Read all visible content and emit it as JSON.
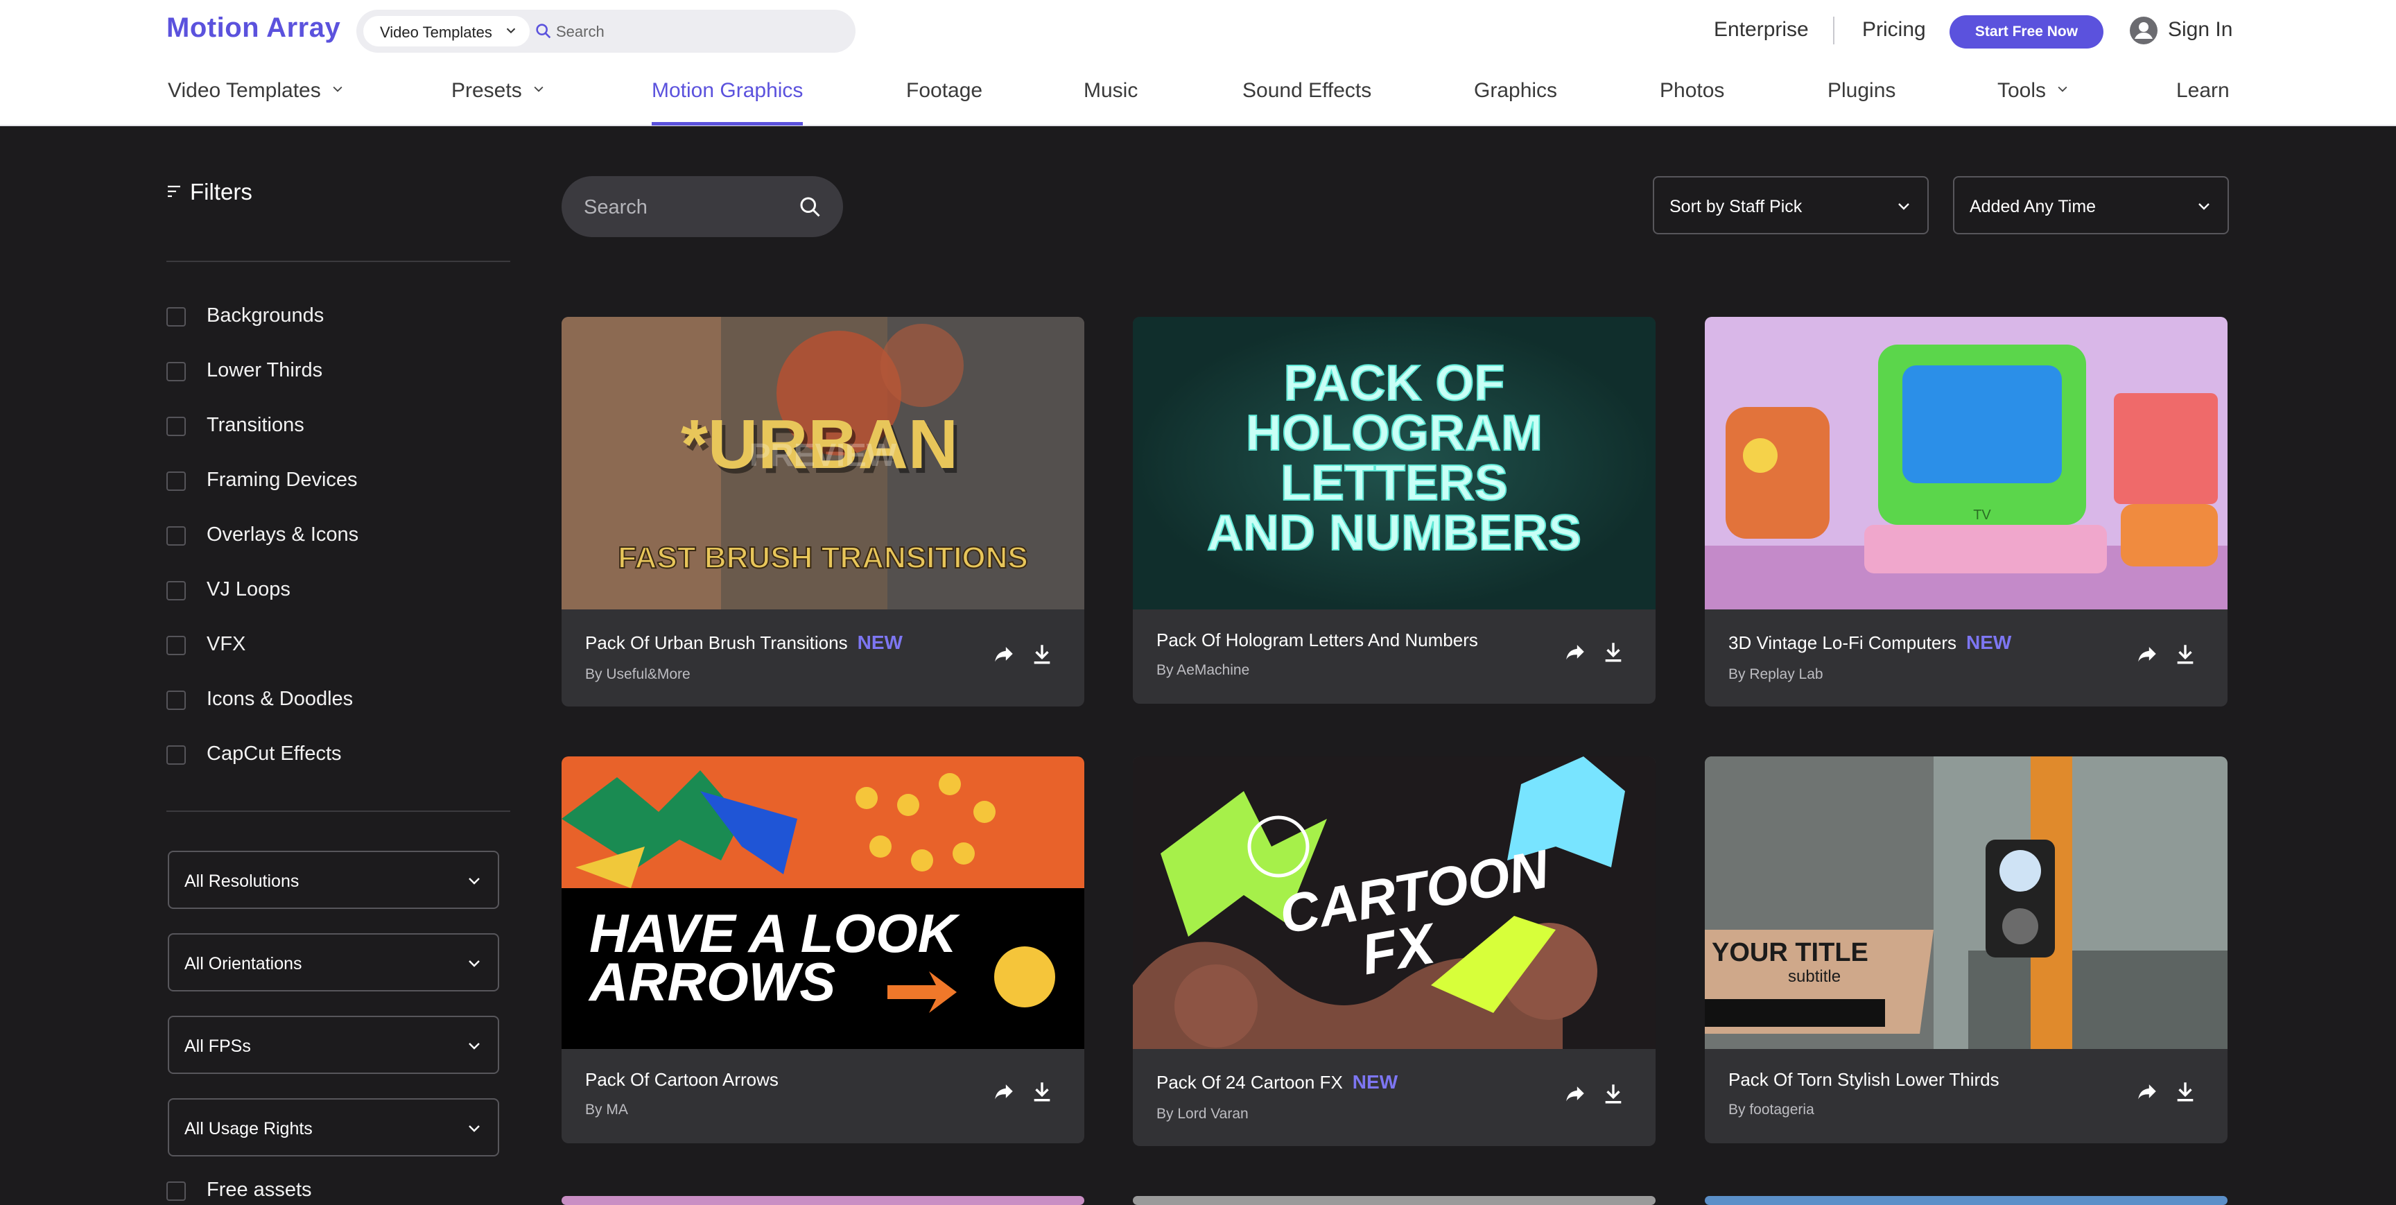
{
  "brand": {
    "logo": "Motion Array"
  },
  "top_search": {
    "category": "Video Templates",
    "placeholder": "Search"
  },
  "top_links": {
    "enterprise": "Enterprise",
    "pricing": "Pricing",
    "cta": "Start Free Now",
    "sign_in": "Sign In"
  },
  "nav": {
    "items": [
      {
        "label": "Video Templates"
      },
      {
        "label": "Presets"
      },
      {
        "label": "Motion Graphics"
      },
      {
        "label": "Footage"
      },
      {
        "label": "Music"
      },
      {
        "label": "Sound Effects"
      },
      {
        "label": "Graphics"
      },
      {
        "label": "Photos"
      },
      {
        "label": "Plugins"
      },
      {
        "label": "Tools"
      },
      {
        "label": "Learn"
      }
    ],
    "active": "Motion Graphics"
  },
  "sidebar": {
    "title": "Filters",
    "categories": [
      {
        "label": "Backgrounds"
      },
      {
        "label": "Lower Thirds"
      },
      {
        "label": "Transitions"
      },
      {
        "label": "Framing Devices"
      },
      {
        "label": "Overlays & Icons"
      },
      {
        "label": "VJ Loops"
      },
      {
        "label": "VFX"
      },
      {
        "label": "Icons & Doodles"
      },
      {
        "label": "CapCut Effects"
      }
    ],
    "selects": [
      {
        "label": "All Resolutions"
      },
      {
        "label": "All Orientations"
      },
      {
        "label": "All FPSs"
      },
      {
        "label": "All Usage Rights"
      }
    ],
    "free_assets": "Free assets"
  },
  "toolbar": {
    "search_placeholder": "Search",
    "sort": "Sort by Staff Pick",
    "added": "Added Any Time"
  },
  "cards": [
    {
      "title": "Pack Of Urban Brush Transitions",
      "badge": "NEW",
      "author": "By Useful&More",
      "thumb_text": "*URBAN",
      "thumb_sub": "FAST BRUSH TRANSITIONS",
      "thumb_mark": "PREVIEW"
    },
    {
      "title": "Pack Of Hologram Letters And Numbers",
      "badge": "",
      "author": "By AeMachine",
      "thumb_lines": [
        "PACK OF",
        "HOLOGRAM",
        "LETTERS",
        "AND NUMBERS"
      ]
    },
    {
      "title": "3D Vintage Lo-Fi Computers",
      "badge": "NEW",
      "author": "By Replay Lab",
      "thumb_mark": "TV"
    },
    {
      "title": "Pack Of Cartoon Arrows",
      "badge": "",
      "author": "By MA",
      "thumb_lines": [
        "HAVE A LOOK",
        "ARROWS"
      ]
    },
    {
      "title": "Pack Of 24 Cartoon FX",
      "badge": "NEW",
      "author": "By Lord Varan",
      "thumb_lines": [
        "CARTOON",
        "FX"
      ]
    },
    {
      "title": "Pack Of Torn Stylish Lower Thirds",
      "badge": "",
      "author": "By footageria",
      "thumb_lines": [
        "YOUR TITLE",
        "subtitle"
      ]
    }
  ],
  "colors": {
    "accent": "#5b52dd",
    "badge": "#7d76f2",
    "page_bg": "#1c1b1d",
    "card_bg": "#323235"
  }
}
